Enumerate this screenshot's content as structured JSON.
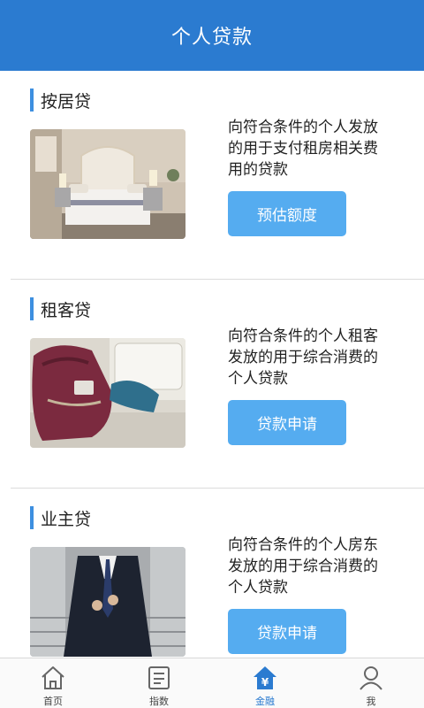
{
  "header": {
    "title": "个人贷款"
  },
  "loans": [
    {
      "title": "按居贷",
      "description": "向符合条件的个人发放的用于支付租房相关费用的贷款",
      "button": "预估额度"
    },
    {
      "title": "租客贷",
      "description": "向符合条件的个人租客发放的用于综合消费的个人贷款",
      "button": "贷款申请"
    },
    {
      "title": "业主贷",
      "description": "向符合条件的个人房东发放的用于综合消费的个人贷款",
      "button": "贷款申请"
    }
  ],
  "tabs": [
    {
      "label": "首页",
      "icon": "home-icon"
    },
    {
      "label": "指数",
      "icon": "index-icon"
    },
    {
      "label": "金融",
      "icon": "finance-icon",
      "active": true
    },
    {
      "label": "我",
      "icon": "profile-icon"
    }
  ],
  "colors": {
    "header": "#2b7bd0",
    "accent_bar": "#3d8fe0",
    "button": "#55acf0",
    "active_tab": "#2b7bd0"
  }
}
